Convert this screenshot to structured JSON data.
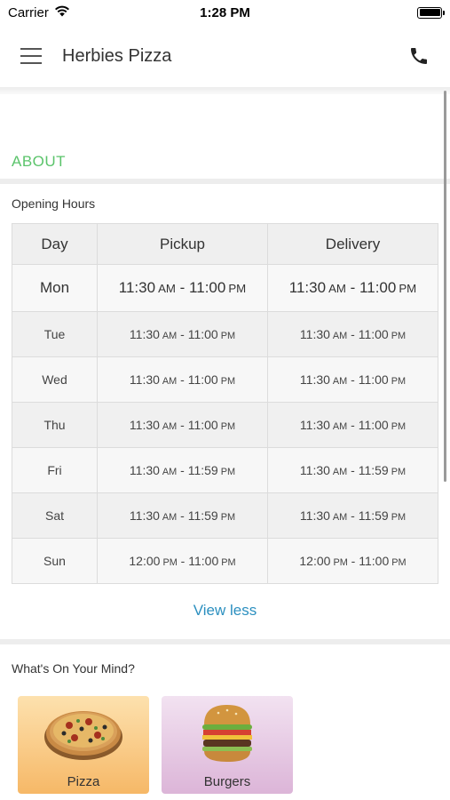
{
  "status_bar": {
    "carrier": "Carrier",
    "time": "1:28 PM"
  },
  "header": {
    "title": "Herbies Pizza",
    "menu_icon": "hamburger-menu-icon",
    "call_icon": "phone-icon"
  },
  "about": {
    "title": "ABOUT"
  },
  "opening_hours": {
    "label": "Opening Hours",
    "columns": [
      "Day",
      "Pickup",
      "Delivery"
    ],
    "rows": [
      {
        "day": "Mon",
        "pickup": {
          "open": "11:30",
          "open_ampm": "AM",
          "close": "11:00",
          "close_ampm": "PM"
        },
        "delivery": {
          "open": "11:30",
          "open_ampm": "AM",
          "close": "11:00",
          "close_ampm": "PM"
        }
      },
      {
        "day": "Tue",
        "pickup": {
          "open": "11:30",
          "open_ampm": "AM",
          "close": "11:00",
          "close_ampm": "PM"
        },
        "delivery": {
          "open": "11:30",
          "open_ampm": "AM",
          "close": "11:00",
          "close_ampm": "PM"
        }
      },
      {
        "day": "Wed",
        "pickup": {
          "open": "11:30",
          "open_ampm": "AM",
          "close": "11:00",
          "close_ampm": "PM"
        },
        "delivery": {
          "open": "11:30",
          "open_ampm": "AM",
          "close": "11:00",
          "close_ampm": "PM"
        }
      },
      {
        "day": "Thu",
        "pickup": {
          "open": "11:30",
          "open_ampm": "AM",
          "close": "11:00",
          "close_ampm": "PM"
        },
        "delivery": {
          "open": "11:30",
          "open_ampm": "AM",
          "close": "11:00",
          "close_ampm": "PM"
        }
      },
      {
        "day": "Fri",
        "pickup": {
          "open": "11:30",
          "open_ampm": "AM",
          "close": "11:59",
          "close_ampm": "PM"
        },
        "delivery": {
          "open": "11:30",
          "open_ampm": "AM",
          "close": "11:59",
          "close_ampm": "PM"
        }
      },
      {
        "day": "Sat",
        "pickup": {
          "open": "11:30",
          "open_ampm": "AM",
          "close": "11:59",
          "close_ampm": "PM"
        },
        "delivery": {
          "open": "11:30",
          "open_ampm": "AM",
          "close": "11:59",
          "close_ampm": "PM"
        }
      },
      {
        "day": "Sun",
        "pickup": {
          "open": "12:00",
          "open_ampm": "PM",
          "close": "11:00",
          "close_ampm": "PM"
        },
        "delivery": {
          "open": "12:00",
          "open_ampm": "PM",
          "close": "11:00",
          "close_ampm": "PM"
        }
      }
    ],
    "view_less": "View less"
  },
  "whats_on_your_mind": {
    "label": "What's On Your Mind?",
    "categories": [
      {
        "label": "Pizza",
        "icon": "pizza-icon"
      },
      {
        "label": "Burgers",
        "icon": "burger-icon"
      }
    ]
  },
  "colors": {
    "accent_green": "#5bc46b",
    "link_blue": "#2b8fbf"
  }
}
